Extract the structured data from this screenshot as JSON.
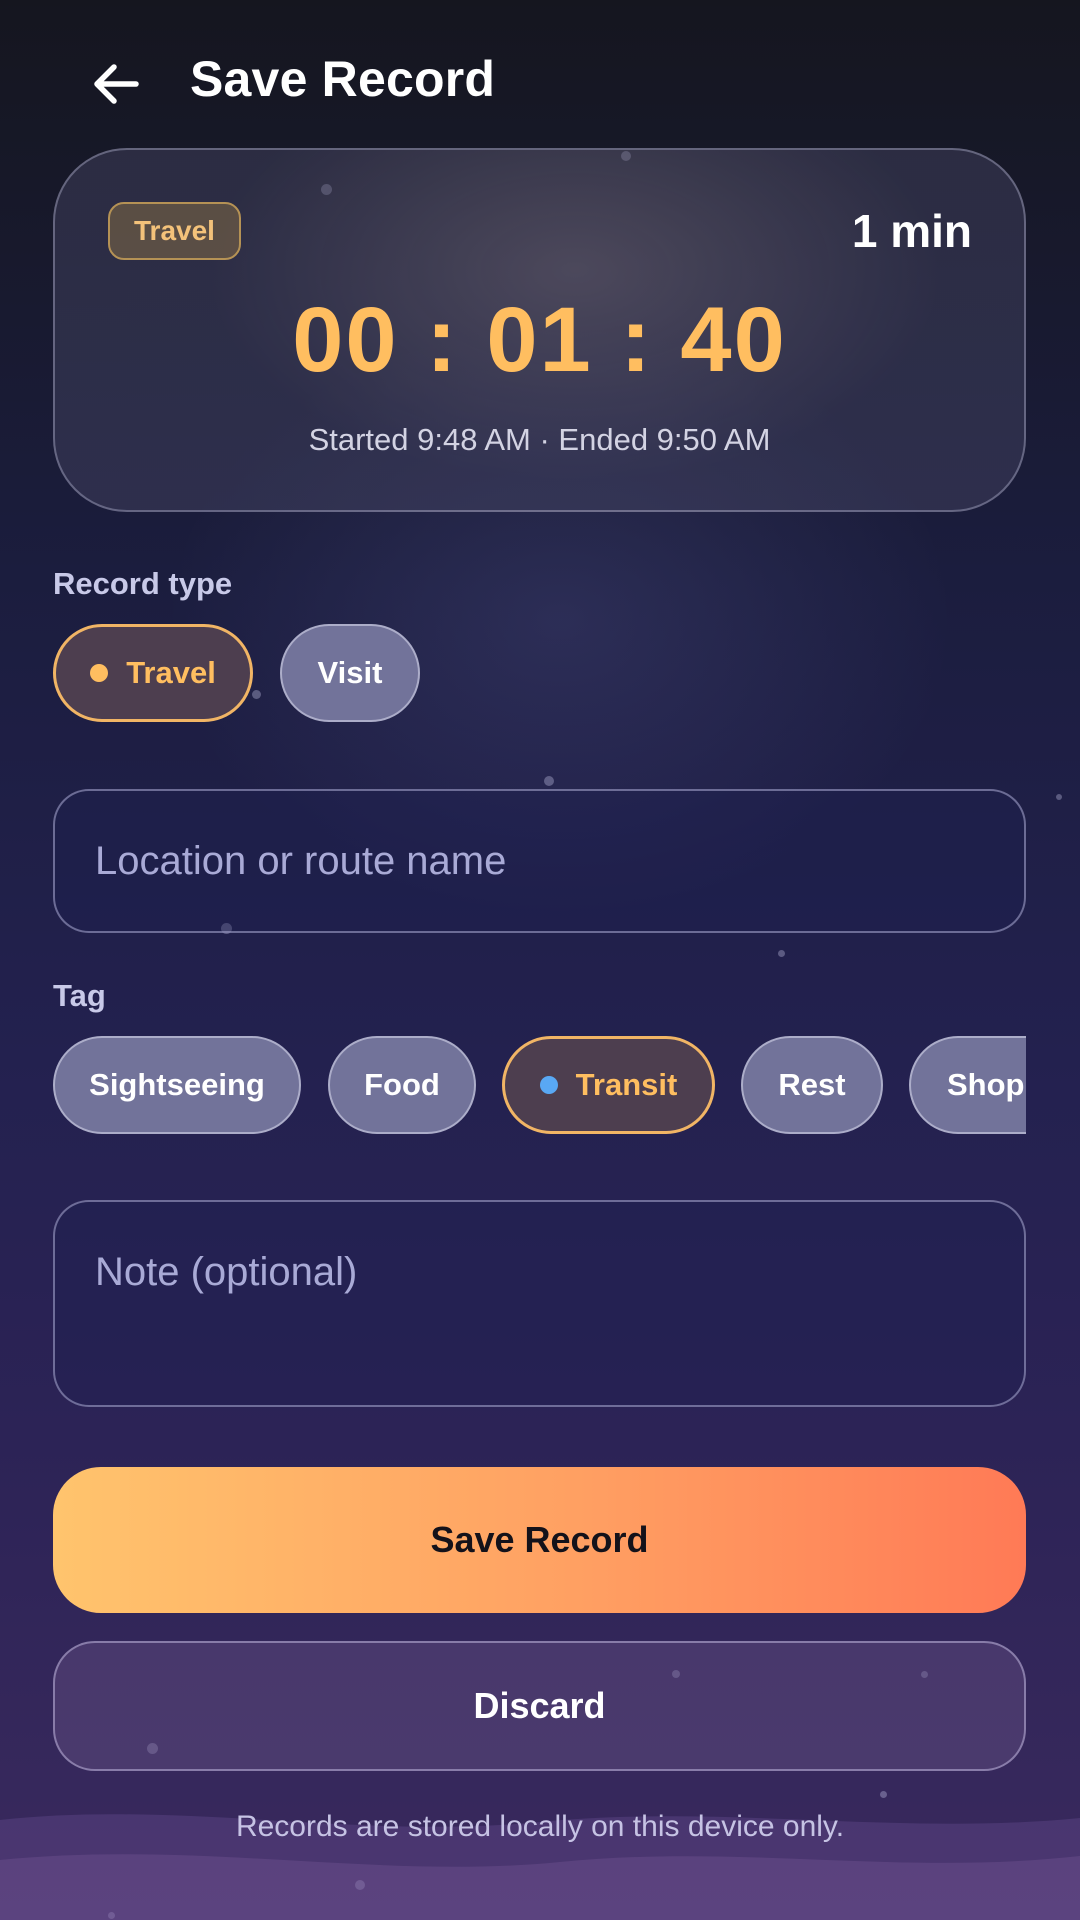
{
  "header": {
    "title": "Save Record",
    "back_icon": "arrow-left-icon"
  },
  "timer_card": {
    "type_badge": "Travel",
    "duration_label": "1 min",
    "elapsed": "00 : 01 : 40",
    "subtitle": "Started 9:48 AM · Ended 9:50 AM"
  },
  "record_type": {
    "label": "Record type",
    "options": [
      {
        "label": "Travel",
        "selected": true
      },
      {
        "label": "Visit",
        "selected": false
      }
    ],
    "selected_bullet_color": "#ffbe60"
  },
  "location_input": {
    "value": "",
    "placeholder": "Location or route name"
  },
  "tag": {
    "label": "Tag",
    "options": [
      {
        "label": "Sightseeing",
        "selected": false
      },
      {
        "label": "Food",
        "selected": false
      },
      {
        "label": "Transit",
        "selected": true
      },
      {
        "label": "Rest",
        "selected": false
      },
      {
        "label": "Shopping",
        "selected": false
      }
    ],
    "selected_bullet_color": "#59a8f4"
  },
  "note_input": {
    "value": "",
    "placeholder": "Note (optional)"
  },
  "actions": {
    "save_label": "Save Record",
    "discard_label": "Discard"
  },
  "footer": {
    "note": "Records are stored locally on this device only."
  },
  "colors": {
    "accent_orange": "#ffbe60",
    "gradient_start": "#ffc46d",
    "gradient_end": "#ff7a56"
  }
}
